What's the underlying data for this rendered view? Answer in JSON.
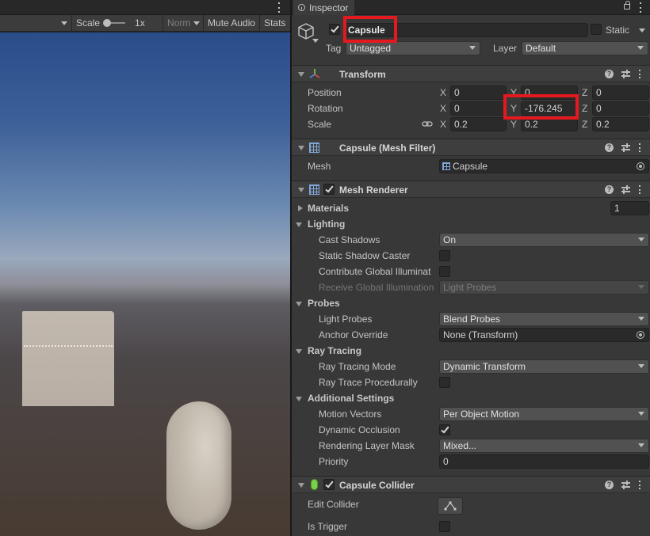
{
  "game_toolbar": {
    "scale_label": "Scale",
    "scale_value": "1x",
    "aspect_label": "Norm",
    "mute_label": "Mute Audio",
    "stats_label": "Stats"
  },
  "inspector": {
    "tab_label": "Inspector",
    "object": {
      "name": "Capsule",
      "static_label": "Static",
      "tag_label": "Tag",
      "tag_value": "Untagged",
      "layer_label": "Layer",
      "layer_value": "Default"
    },
    "transform": {
      "title": "Transform",
      "position_label": "Position",
      "rotation_label": "Rotation",
      "scale_label": "Scale",
      "axis_x": "X",
      "axis_y": "Y",
      "axis_z": "Z",
      "position": {
        "x": "0",
        "y": "0",
        "z": "0"
      },
      "rotation": {
        "x": "0",
        "y": "-176.245",
        "z": "0"
      },
      "scale": {
        "x": "0.2",
        "y": "0.2",
        "z": "0.2"
      }
    },
    "mesh_filter": {
      "title": "Capsule (Mesh Filter)",
      "mesh_label": "Mesh",
      "mesh_value": "Capsule"
    },
    "mesh_renderer": {
      "title": "Mesh Renderer",
      "materials_label": "Materials",
      "materials_count": "1",
      "lighting_label": "Lighting",
      "cast_shadows_label": "Cast Shadows",
      "cast_shadows_value": "On",
      "static_shadow_label": "Static Shadow Caster",
      "contribute_gi_label": "Contribute Global Illuminat",
      "receive_gi_label": "Receive Global Illumination",
      "receive_gi_value": "Light Probes",
      "probes_label": "Probes",
      "light_probes_label": "Light Probes",
      "light_probes_value": "Blend Probes",
      "anchor_label": "Anchor Override",
      "anchor_value": "None (Transform)",
      "ray_tracing_label": "Ray Tracing",
      "rt_mode_label": "Ray Tracing Mode",
      "rt_mode_value": "Dynamic Transform",
      "rt_proc_label": "Ray Trace Procedurally",
      "additional_label": "Additional Settings",
      "motion_label": "Motion Vectors",
      "motion_value": "Per Object Motion",
      "occlusion_label": "Dynamic Occlusion",
      "mask_label": "Rendering Layer Mask",
      "mask_value": "Mixed...",
      "priority_label": "Priority",
      "priority_value": "0"
    },
    "capsule_collider": {
      "title": "Capsule Collider",
      "edit_label": "Edit Collider",
      "trigger_label": "Is Trigger"
    }
  },
  "colors": {
    "highlight_box": "#e3191d",
    "panel_bg": "#383838",
    "header_bg": "#3e3e3e"
  }
}
